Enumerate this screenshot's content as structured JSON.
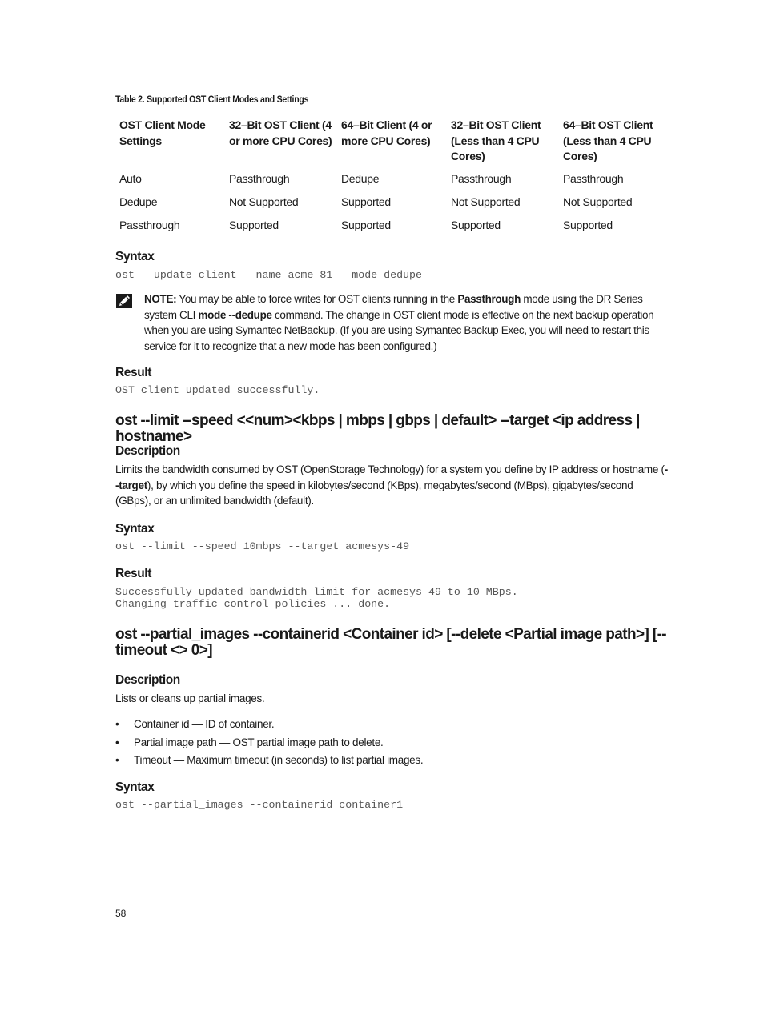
{
  "table": {
    "caption": "Table 2. Supported OST Client Modes and Settings",
    "headers": [
      "OST Client Mode Settings",
      "32–Bit OST Client (4 or more CPU Cores)",
      "64–Bit Client (4 or more CPU Cores)",
      "32–Bit OST Client (Less than 4 CPU Cores)",
      "64–Bit OST Client (Less than 4 CPU Cores)"
    ],
    "rows": [
      [
        "Auto",
        "Passthrough",
        "Dedupe",
        "Passthrough",
        "Passthrough"
      ],
      [
        "Dedupe",
        "Not Supported",
        "Supported",
        "Not Supported",
        "Not Supported"
      ],
      [
        "Passthrough",
        "Supported",
        "Supported",
        "Supported",
        "Supported"
      ]
    ]
  },
  "section1": {
    "syntax_heading": "Syntax",
    "syntax_code": "ost --update_client --name acme-81 --mode dedupe",
    "note": {
      "icon": "pencil-note-icon",
      "label": "NOTE:",
      "text_1": " You may be able to force writes for OST clients running in the ",
      "bold_1": "Passthrough",
      "text_2": " mode using the DR Series system CLI ",
      "bold_2": "mode --dedupe",
      "text_3": " command. The change in OST client mode is effective on the next backup operation when you are using Symantec NetBackup. (If you are using Symantec Backup Exec, you will need to restart this service for it to recognize that a new mode has been configured.)"
    },
    "result_heading": "Result",
    "result_code": "OST client updated successfully."
  },
  "section2": {
    "title": "ost --limit --speed <<num><kbps | mbps | gbps | default> --target <ip address | hostname>",
    "description_heading": "Description",
    "description_text_1": "Limits the bandwidth consumed by OST (OpenStorage Technology) for a system you define by IP address or hostname (",
    "description_bold": "--target",
    "description_text_2": "), by which you define the speed in kilobytes/second (KBps), megabytes/second (MBps), gigabytes/second (GBps), or an unlimited bandwidth (default).",
    "syntax_heading": "Syntax",
    "syntax_code": "ost --limit --speed 10mbps --target acmesys-49",
    "result_heading": "Result",
    "result_code": "Successfully updated bandwidth limit for acmesys-49 to 10 MBps.\nChanging traffic control policies ... done."
  },
  "section3": {
    "title": "ost --partial_images --containerid <Container id> [--delete <Partial image path>] [--timeout <> 0>]",
    "title_line1": "ost --partial_images --containerid <Container id> [--delete <Partial image path>] [--",
    "title_line2": "timeout <> 0>]",
    "description_heading": "Description",
    "description_text": "Lists or cleans up partial images.",
    "bullets": [
      "Container id — ID of container.",
      "Partial image path — OST partial image path to delete.",
      "Timeout — Maximum timeout (in seconds) to list partial images."
    ],
    "bullet_glyph": "•",
    "syntax_heading": "Syntax",
    "syntax_code": "ost --partial_images --containerid container1"
  },
  "footer": {
    "page_number": "58"
  }
}
